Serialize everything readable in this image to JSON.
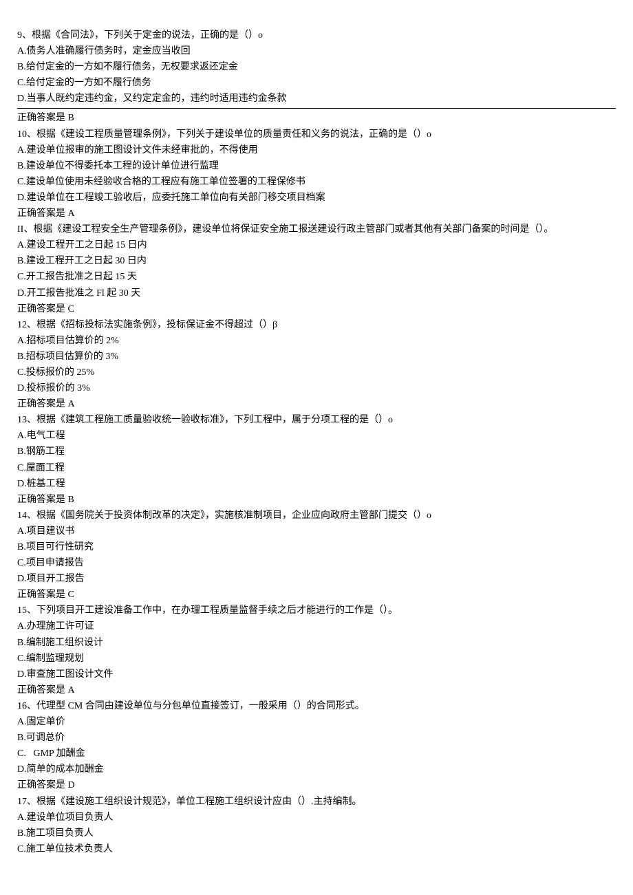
{
  "questions": [
    {
      "stem": "9、根据《合同法》，下列关于定金的说法，正确的是（）o",
      "options": [
        "A.债务人准确履行债务时，定金应当收回",
        "B.给付定金的一方如不履行债务，无权要求返还定金",
        "C.给付定金的一方如不履行债务",
        "D.当事人既约定违约金，又约定定金的，违约时适用违约金条款"
      ],
      "answer": "正确答案是 B",
      "hr_after_options": true
    },
    {
      "stem": "10、根据《建设工程质量管理条例》，下列关于建设单位的质量责任和义务的说法，正确的是（）o",
      "options": [
        "A.建设单位报审的施工图设计文件未经审批的，不得使用",
        "B.建设单位不得委托本工程的设计单位进行监理",
        "C.建设单位使用未经验收合格的工程应有施工单位签署的工程保修书",
        "D.建设单位在工程竣工验收后，应委托施工单位向有关部门移交项目档案"
      ],
      "answer": "正确答案是 A"
    },
    {
      "stem": "II、根据《建设工程安全生产管理条例》，建设单位将保证安全施工报送建设行政主管部门或者其他有关部门备案的时间是（）。",
      "options": [
        "A.建设工程开工之日起 15 日内",
        "B.建设工程开工之日起 30 日内",
        "C.开工报告批准之日起 15 天",
        "D.开工报告批准之 Fl 起 30 天"
      ],
      "answer": "正确答案是 C"
    },
    {
      "stem": "12、根据《招标投标法实施条例》，投标保证金不得超过（）β",
      "options": [
        "A.招标项目估算价的 2%",
        "B.招标项目估算价的 3%",
        "C.投标报价的 25%",
        "D.投标报价的 3%"
      ],
      "answer": "正确答案是 A"
    },
    {
      "stem": "13、根据《建筑工程施工质量验收统一验收标准》，下列工程中，属于分项工程的是（）o",
      "options": [
        "A.电气工程",
        "B.钢筋工程",
        "C.屋面工程",
        "D.桩基工程"
      ],
      "answer": "正确答案是 B"
    },
    {
      "stem": "14、根据《国务院关于投资体制改革的决定》，实施核准制项目，企业应向政府主管部门提交（）o",
      "options": [
        "A.项目建议书",
        "B.项目可行性研究",
        "C.项目申请报告",
        "D.项目开工报告"
      ],
      "answer": "正确答案是 C"
    },
    {
      "stem": "15、下列项目开工建设准备工作中，在办理工程质量监督手续之后才能进行的工作是（）。",
      "options": [
        "A.办理施工许可证",
        "B.编制施工组织设计",
        "C.编制监理规划",
        "D.审查施工图设计文件"
      ],
      "answer": "正确答案是 A"
    },
    {
      "stem": "16、代理型 CM 合同由建设单位与分包单位直接签订，一般采用（）的合同形式。",
      "options": [
        "A.固定单价",
        "B.可调总价",
        "C.   GMP 加酬金",
        "D.简单的成本加酬金"
      ],
      "answer": "正确答案是 D"
    },
    {
      "stem": "17、根据《建设施工组织设计规范》，单位工程施工组织设计应由（）.主持编制。",
      "options": [
        "A.建设单位项目负责人",
        "B.施工项目负责人",
        "C.施工单位技术负责人"
      ]
    }
  ]
}
